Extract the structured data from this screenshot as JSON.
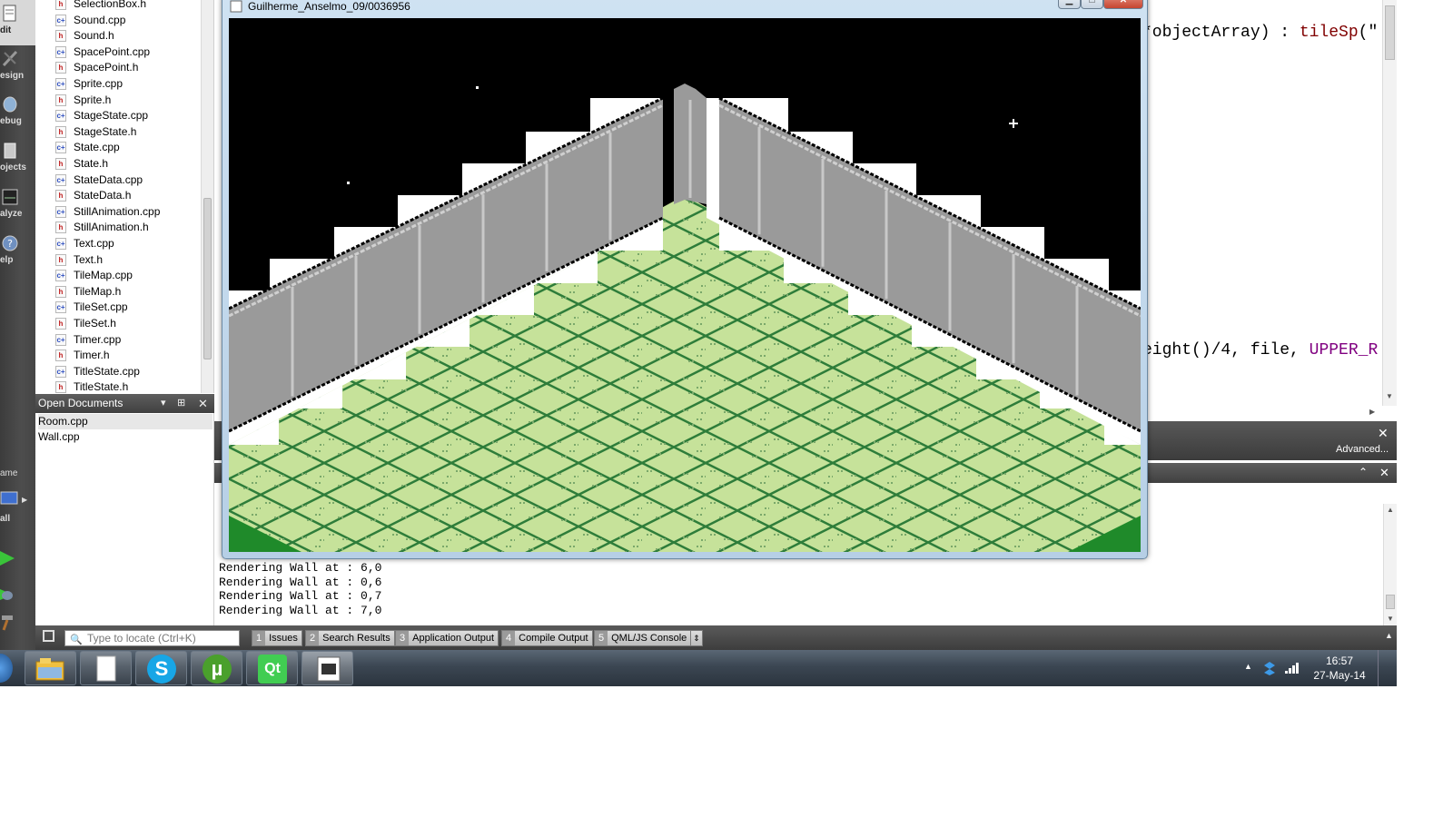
{
  "modes": [
    {
      "label": "dit",
      "icon": "edit-icon"
    },
    {
      "label": "esign",
      "icon": "design-icon"
    },
    {
      "label": "ebug",
      "icon": "debug-icon"
    },
    {
      "label": "ojects",
      "icon": "projects-icon"
    },
    {
      "label": "alyze",
      "icon": "analyze-icon"
    },
    {
      "label": "elp",
      "icon": "help-icon"
    }
  ],
  "kit": {
    "name_label": "ame",
    "build_label": "all"
  },
  "project_tree": {
    "files": [
      {
        "name": "SelectionBox.h",
        "type": "h"
      },
      {
        "name": "Sound.cpp",
        "type": "cpp"
      },
      {
        "name": "Sound.h",
        "type": "h"
      },
      {
        "name": "SpacePoint.cpp",
        "type": "cpp"
      },
      {
        "name": "SpacePoint.h",
        "type": "h"
      },
      {
        "name": "Sprite.cpp",
        "type": "cpp"
      },
      {
        "name": "Sprite.h",
        "type": "h"
      },
      {
        "name": "StageState.cpp",
        "type": "cpp"
      },
      {
        "name": "StageState.h",
        "type": "h"
      },
      {
        "name": "State.cpp",
        "type": "cpp"
      },
      {
        "name": "State.h",
        "type": "h"
      },
      {
        "name": "StateData.cpp",
        "type": "cpp"
      },
      {
        "name": "StateData.h",
        "type": "h"
      },
      {
        "name": "StillAnimation.cpp",
        "type": "cpp"
      },
      {
        "name": "StillAnimation.h",
        "type": "h"
      },
      {
        "name": "Text.cpp",
        "type": "cpp"
      },
      {
        "name": "Text.h",
        "type": "h"
      },
      {
        "name": "TileMap.cpp",
        "type": "cpp"
      },
      {
        "name": "TileMap.h",
        "type": "h"
      },
      {
        "name": "TileSet.cpp",
        "type": "cpp"
      },
      {
        "name": "TileSet.h",
        "type": "h"
      },
      {
        "name": "Timer.cpp",
        "type": "cpp"
      },
      {
        "name": "Timer.h",
        "type": "h"
      },
      {
        "name": "TitleState.cpp",
        "type": "cpp"
      },
      {
        "name": "TitleState.h",
        "type": "h"
      }
    ]
  },
  "open_documents": {
    "title": "Open Documents",
    "items": [
      "Room.cpp",
      "Wall.cpp"
    ]
  },
  "editor": {
    "line1": {
      "a": "*objectArray) : ",
      "b": "tileSp",
      "c": "(\""
    },
    "line2": {
      "a": "eight()/4, file, ",
      "b": "UPPER_R"
    }
  },
  "find": {
    "advanced_label": "Advanced..."
  },
  "output": {
    "lines": [
      "Rendering Wall at : 6,0",
      "Rendering Wall at : 0,6",
      "Rendering Wall at : 0,7",
      "Rendering Wall at : 7,0"
    ]
  },
  "statusbar": {
    "locate_placeholder": "Type to locate (Ctrl+K)",
    "tabs": [
      {
        "num": "1",
        "label": "Issues"
      },
      {
        "num": "2",
        "label": "Search Results"
      },
      {
        "num": "3",
        "label": "Application Output"
      },
      {
        "num": "4",
        "label": "Compile Output"
      },
      {
        "num": "5",
        "label": "QML/JS Console"
      }
    ]
  },
  "game_window": {
    "title": "Guilherme_Anselmo_09/0036956",
    "colors": {
      "sky": "#000000",
      "floor_light": "#c6e29a",
      "floor_dark": "#2e7d3a",
      "wall": "#9a9a9a",
      "wall_light": "#c8c8c8"
    }
  },
  "taskbar": {
    "apps": [
      "explorer-icon",
      "blank-document-icon",
      "skype-icon",
      "utorrent-icon",
      "qt-creator-icon",
      "game-window-icon"
    ],
    "time": "16:57",
    "date": "27-May-14"
  }
}
